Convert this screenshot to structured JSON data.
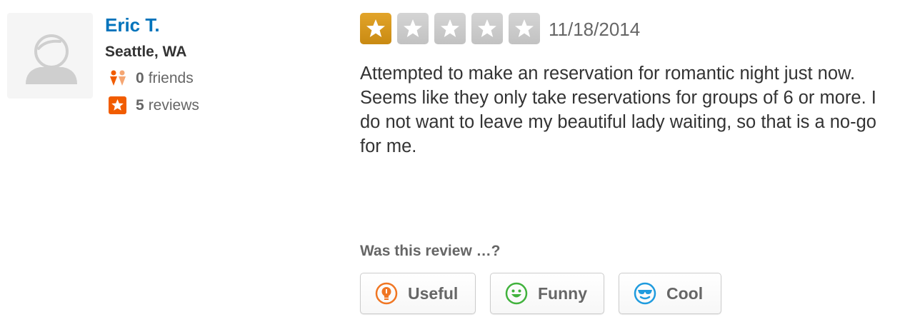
{
  "user": {
    "name": "Eric T.",
    "location": "Seattle, WA",
    "friends_count": "0",
    "friends_label": "friends",
    "reviews_count": "5",
    "reviews_label": "reviews"
  },
  "review": {
    "rating": 1,
    "max_rating": 5,
    "date": "11/18/2014",
    "text": "Attempted to make an reservation for romantic night just now. Seems like they only take reservations for groups of 6 or more. I do not want to leave my beautiful lady waiting, so that is a no-go for me."
  },
  "voting": {
    "question": "Was this review …?",
    "buttons": {
      "useful": "Useful",
      "funny": "Funny",
      "cool": "Cool"
    }
  },
  "colors": {
    "user_link": "#0073bb",
    "star_filled": "#d4961c",
    "star_empty": "#cccccc",
    "useful_icon": "#f07623",
    "funny_icon": "#41b23d",
    "cool_icon": "#1f9bde",
    "friends_icon": "#f15c00",
    "reviews_icon": "#f15c00"
  },
  "icons": {
    "avatar": "default-user-avatar",
    "friends": "friends-icon",
    "reviews": "star-badge-icon",
    "useful": "lightbulb-icon",
    "funny": "smiley-icon",
    "cool": "sunglasses-icon"
  }
}
